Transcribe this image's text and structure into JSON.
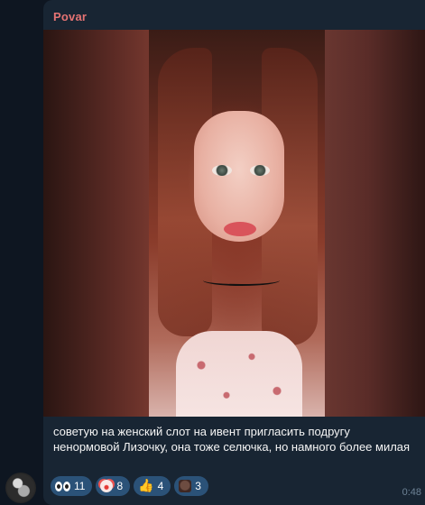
{
  "message": {
    "sender": "Povar",
    "caption": "советую на женский слот на ивент пригласить подругу ненормовой Лизочку, она тоже селючка, но намного более милая",
    "time": "0:48"
  },
  "reactions": [
    {
      "icon": "eyes-emoji",
      "count": "11"
    },
    {
      "icon": "clown-emoji",
      "count": "8"
    },
    {
      "icon": "thumbs-up-emoji",
      "count": "4"
    },
    {
      "icon": "face-emoji",
      "count": "3"
    }
  ],
  "colors": {
    "background": "#0e1621",
    "bubble": "#182533",
    "sender": "#e57373",
    "reaction_bg": "#2b5278",
    "time": "#6d8295"
  }
}
